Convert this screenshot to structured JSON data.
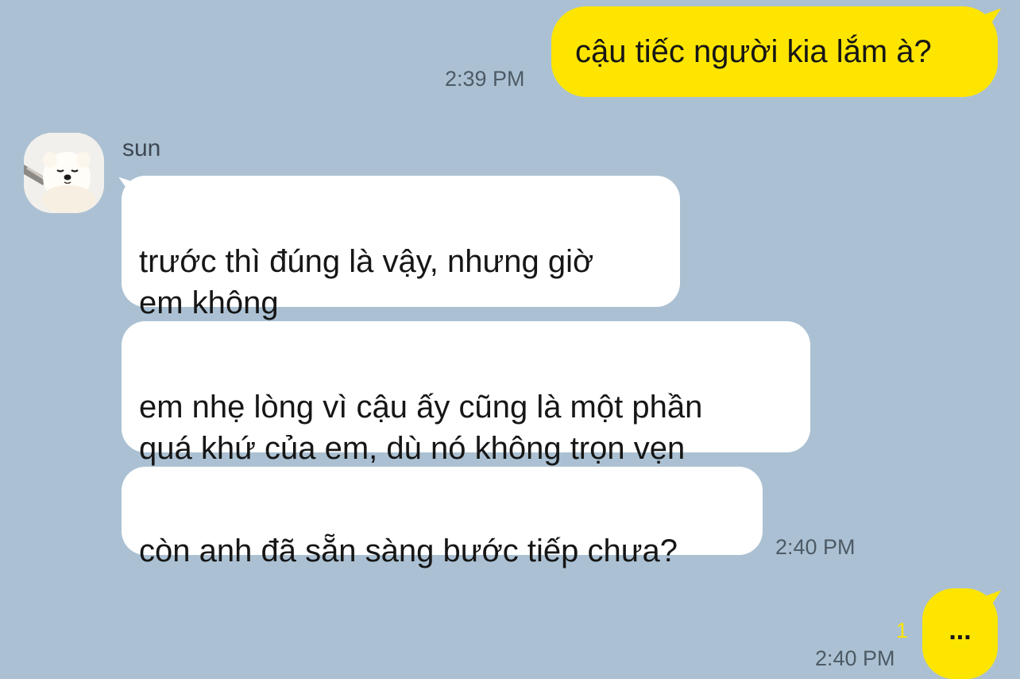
{
  "theme": {
    "background": "#abc1d3",
    "outgoing_bubble": "#fee500",
    "incoming_bubble": "#ffffff",
    "unread_color": "#fee500"
  },
  "messages": {
    "m1": {
      "text": "cậu tiếc người kia lắm à?",
      "time": "2:39 PM"
    },
    "sender": {
      "name": "sun",
      "avatar_icon": "pomeranian-avatar-icon"
    },
    "m2": {
      "text": "trước thì đúng là vậy, nhưng giờ\nem không"
    },
    "m3": {
      "text": "em nhẹ lòng vì cậu ấy cũng là một phần\nquá khứ của em, dù nó không trọn vẹn"
    },
    "m4": {
      "text": "còn anh đã sẵn sàng bước tiếp chưa?",
      "time": "2:40 PM"
    },
    "m5": {
      "text": "...",
      "time": "2:40 PM",
      "unread_count": "1"
    }
  }
}
